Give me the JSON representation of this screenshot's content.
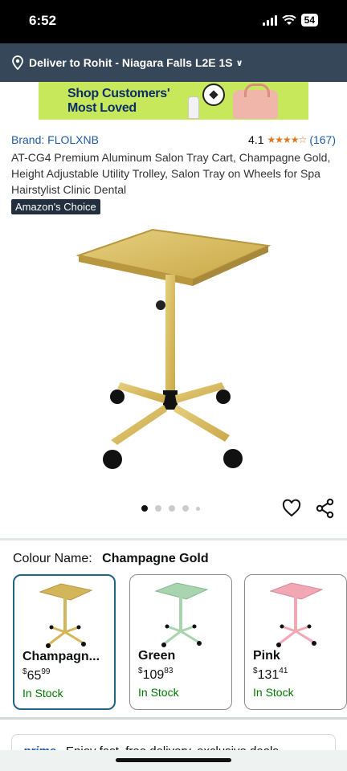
{
  "status_bar": {
    "time": "6:52",
    "battery": "54"
  },
  "deliver": {
    "text": "Deliver to Rohit - Niagara Falls L2E 1S"
  },
  "banner": {
    "line1": "Shop Customers'",
    "line2": "Most Loved"
  },
  "product": {
    "brand": "Brand: FLOLXNB",
    "rating": "4.1",
    "stars_shown": 4,
    "stars_total": 5,
    "rating_count": "(167)",
    "title": "AT-CG4 Premium Aluminum Salon Tray Cart, Champagne Gold, Height Adjustable Utility Trolley, Salon Tray on Wheels for Spa Hairstylist Clinic Dental",
    "badge": "Amazon's Choice"
  },
  "gallery": {
    "dot_count": 5,
    "active_index": 0
  },
  "colour": {
    "label": "Colour Name:",
    "selected": "Champagne Gold"
  },
  "variants": [
    {
      "name": "Champagn...",
      "currency": "$",
      "price_whole": "65",
      "price_fraction": "99",
      "stock": "In Stock",
      "color": "#d4b65a",
      "selected": true
    },
    {
      "name": "Green",
      "currency": "$",
      "price_whole": "109",
      "price_fraction": "83",
      "stock": "In Stock",
      "color": "#a8d5b0",
      "selected": false
    },
    {
      "name": "Pink",
      "currency": "$",
      "price_whole": "131",
      "price_fraction": "41",
      "stock": "In Stock",
      "color": "#f2a7b5",
      "selected": false
    }
  ],
  "prime": {
    "logo": "prime",
    "text": "Enjoy fast, free delivery, exclusive deals"
  },
  "colors": {
    "header_bg": "#37475a",
    "link": "#1f5aa8",
    "in_stock": "#007600",
    "selected_border": "#1f6385"
  }
}
